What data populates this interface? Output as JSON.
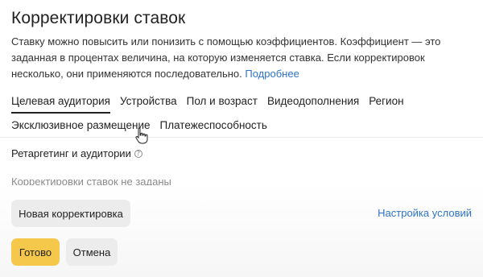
{
  "title": "Корректировки ставок",
  "description": {
    "text": "Ставку можно повысить или понизить с помощью коэффициентов. Коэффициент — это заданная в процентах величина, на которую изменяется ставка. Если корректировок несколько, они применяются последовательно. ",
    "link": "Подробнее"
  },
  "tabs": {
    "row1": [
      {
        "label": "Целевая аудитория",
        "active": true
      },
      {
        "label": "Устройства"
      },
      {
        "label": "Пол и возраст"
      },
      {
        "label": "Видеодополнения"
      },
      {
        "label": "Регион"
      }
    ],
    "row2": [
      {
        "label": "Эксклюзивное размещение"
      },
      {
        "label": "Платежеспособность"
      }
    ]
  },
  "section": {
    "label": "Ретаргетинг и аудитории",
    "help_icon": "question-circle-icon",
    "empty_text": "Корректировки ставок не заданы"
  },
  "actions": {
    "new_label": "Новая корректировка",
    "settings_link": "Настройка условий",
    "done_label": "Готово",
    "cancel_label": "Отмена"
  },
  "colors": {
    "accent": "#f5c84b",
    "link": "#2e73c9",
    "secondary_button": "#ececec"
  },
  "cursor_icon": "hand-pointer-icon"
}
